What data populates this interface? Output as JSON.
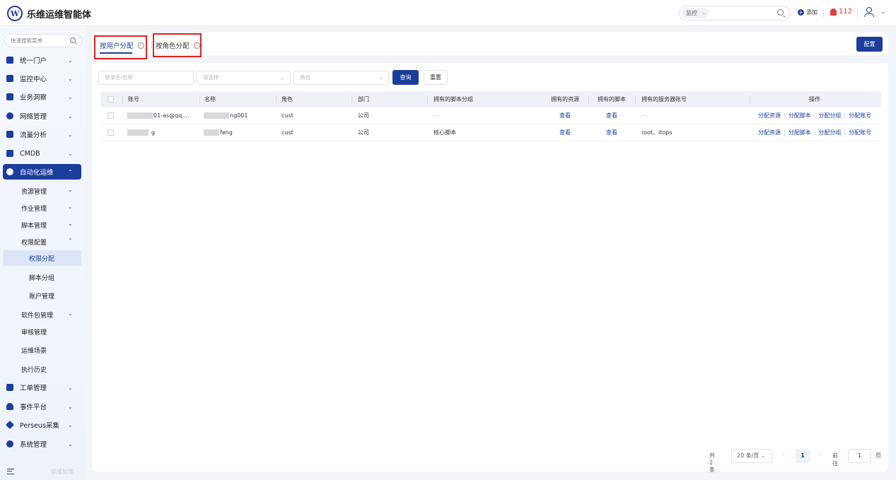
{
  "app": {
    "logo_letter": "W",
    "title": "乐维运维智能体"
  },
  "topbar": {
    "search_scope": "监控",
    "add_label": "添加",
    "alert_count": "112"
  },
  "sidebar": {
    "search_placeholder": "快速搜索菜单",
    "items": [
      {
        "label": "统一门户"
      },
      {
        "label": "监控中心"
      },
      {
        "label": "业务洞察"
      },
      {
        "label": "网络管理"
      },
      {
        "label": "流量分析"
      },
      {
        "label": "CMDB"
      },
      {
        "label": "自动化运维"
      }
    ],
    "auto_sub": [
      {
        "label": "资源管理"
      },
      {
        "label": "作业管理"
      },
      {
        "label": "脚本管理"
      },
      {
        "label": "权限配置"
      }
    ],
    "perm_sub": [
      {
        "label": "权限分配"
      },
      {
        "label": "脚本分组"
      },
      {
        "label": "账户管理"
      }
    ],
    "auto_sub2": [
      {
        "label": "软件包管理"
      },
      {
        "label": "审核管理"
      },
      {
        "label": "运维场景"
      },
      {
        "label": "执行历史"
      }
    ],
    "bottom_items": [
      {
        "label": "工单管理"
      },
      {
        "label": "事件平台"
      },
      {
        "label": "Perseus采集"
      },
      {
        "label": "系统管理"
      }
    ],
    "footer_text": "运维知库"
  },
  "tabs": {
    "by_user": "按用户分配",
    "by_role": "按角色分配",
    "config_button": "配置"
  },
  "filters": {
    "login_placeholder": "登录名/名称",
    "select_placeholder": "请选择",
    "role_placeholder": "角色",
    "query_button": "查询",
    "reset_button": "重置"
  },
  "table": {
    "headers": {
      "account": "账号",
      "name": "名称",
      "role": "角色",
      "dept": "部门",
      "script_groups": "拥有的脚本分组",
      "resources": "拥有的资源",
      "scripts": "拥有的脚本",
      "server_accounts": "拥有的服务器账号",
      "actions": "操作"
    },
    "rows": [
      {
        "account": "01-as@qq....",
        "name": "ng001",
        "role": "cust",
        "dept": "公司",
        "script_groups": "—",
        "resources": "查看",
        "scripts": "查看",
        "server_accounts": "—"
      },
      {
        "account": "g",
        "name": "feng",
        "role": "cust",
        "dept": "公司",
        "script_groups": "核心脚本",
        "resources": "查看",
        "scripts": "查看",
        "server_accounts": "root、itops"
      }
    ],
    "actions": {
      "assign_resource": "分配资源",
      "assign_script": "分配脚本",
      "assign_group": "分配分组",
      "assign_account": "分配账号"
    }
  },
  "pagination": {
    "total": "共 2 条",
    "page_size": "20 条/页",
    "current_page": "1",
    "goto_label": "前往",
    "goto_value": "1",
    "page_suffix": "页"
  },
  "colors": {
    "primary": "#1b3d9c",
    "highlight": "#e3231f",
    "alert": "#e23b3b"
  }
}
